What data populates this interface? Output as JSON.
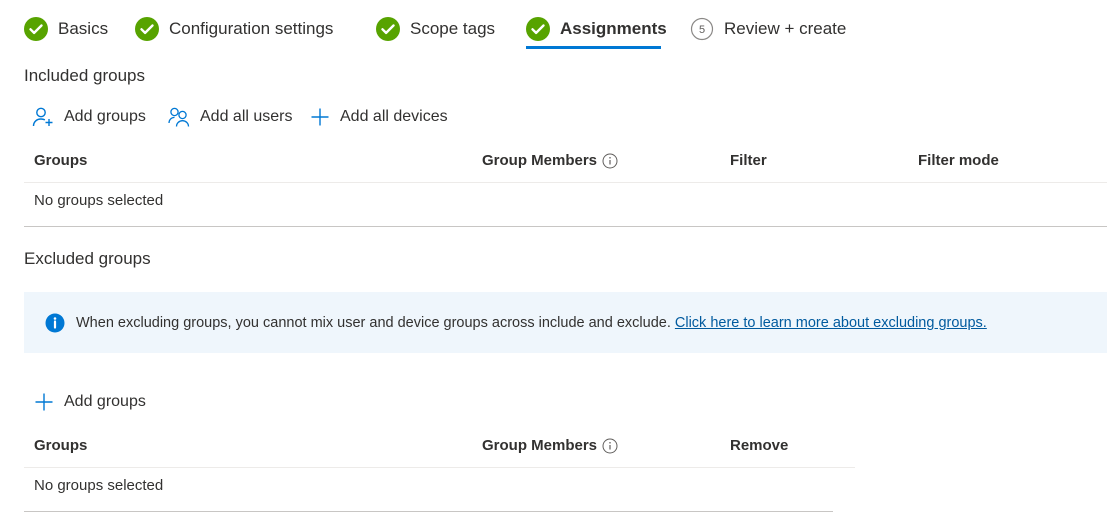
{
  "wizard": {
    "steps": [
      {
        "label": "Basics",
        "state": "complete"
      },
      {
        "label": "Configuration settings",
        "state": "complete"
      },
      {
        "label": "Scope tags",
        "state": "complete"
      },
      {
        "label": "Assignments",
        "state": "active"
      },
      {
        "label": "Review + create",
        "state": "pending",
        "number": "5"
      }
    ]
  },
  "included": {
    "title": "Included groups",
    "actions": {
      "add_groups": "Add groups",
      "add_all_users": "Add all users",
      "add_all_devices": "Add all devices"
    },
    "columns": [
      "Groups",
      "Group Members",
      "Filter",
      "Filter mode"
    ],
    "empty_text": "No groups selected"
  },
  "excluded": {
    "title": "Excluded groups",
    "info": {
      "text": "When excluding groups, you cannot mix user and device groups across include and exclude.",
      "link": "Click here to learn more about excluding groups."
    },
    "actions": {
      "add_groups": "Add groups"
    },
    "columns": [
      "Groups",
      "Group Members",
      "Remove"
    ],
    "empty_text": "No groups selected"
  },
  "colors": {
    "complete": "#57a300",
    "accent": "#0078d4",
    "info_bg": "#eff6fc",
    "link": "#005a9e"
  },
  "icons": {
    "complete": "checkmark-circle-icon",
    "pending": "numbered-circle-icon",
    "add_groups": "add-person-icon",
    "add_all_users": "people-icon",
    "add": "plus-icon",
    "info": "info-icon",
    "column_info": "info-outline-icon"
  }
}
